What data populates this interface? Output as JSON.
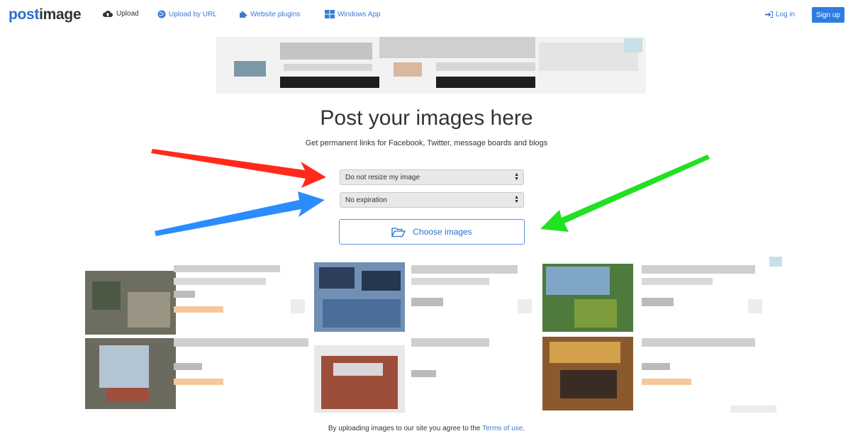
{
  "nav": {
    "logo_post": "post",
    "logo_image": "image",
    "links": [
      {
        "label": "Upload",
        "icon": "cloud-upload-icon"
      },
      {
        "label": "Upload by URL",
        "icon": "globe-icon"
      },
      {
        "label": "Website plugins",
        "icon": "puzzle-icon"
      },
      {
        "label": "Windows App",
        "icon": "windows-icon"
      }
    ],
    "login": "Log in",
    "signup": "Sign up"
  },
  "main": {
    "title": "Post your images here",
    "subtitle": "Get permanent links for Facebook, Twitter, message boards and blogs",
    "resize_select": "Do not resize my image",
    "expiration_select": "No expiration",
    "choose_button": "Choose images"
  },
  "footer": {
    "text": "By uploading images to our site you agree to the",
    "terms_link": "Terms of use",
    "end": "."
  },
  "colors": {
    "accent": "#2d7de0",
    "arrow_red": "#ff2a1a",
    "arrow_blue": "#2a8cff",
    "arrow_green": "#22e022"
  }
}
